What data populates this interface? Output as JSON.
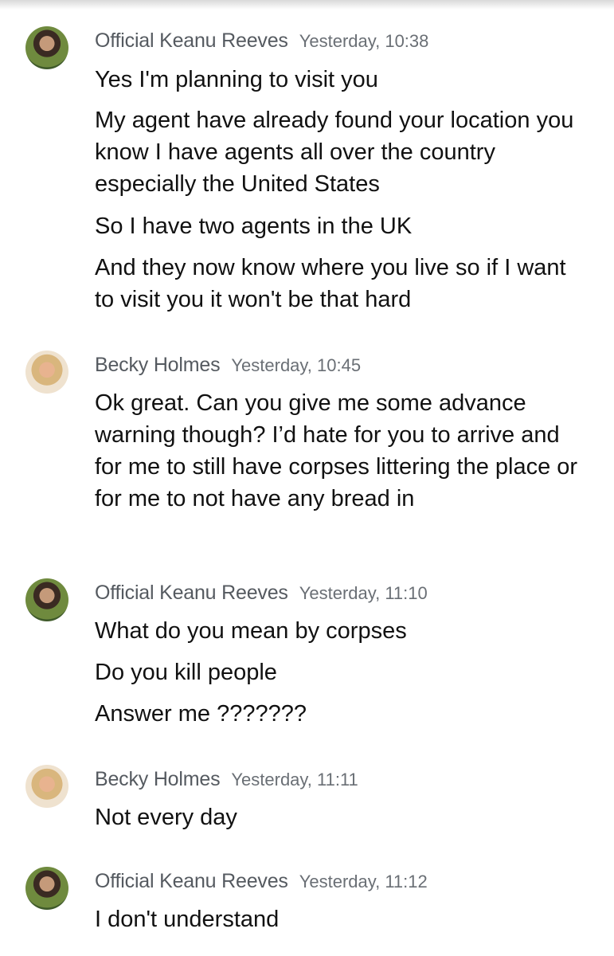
{
  "messages": [
    {
      "sender": "Official Keanu Reeves",
      "time": "Yesterday, 10:38",
      "avatar": "keanu-avatar",
      "lines": [
        "Yes I'm planning to visit you",
        "My agent have already found your location you know I have agents all over the country especially the United States",
        "So I have two agents in the UK",
        "And they now know where you live so if I want to visit you it won't be that hard"
      ]
    },
    {
      "sender": "Becky Holmes",
      "time": "Yesterday, 10:45",
      "avatar": "becky-avatar",
      "lines": [
        "Ok great. Can you give me some advance warning though? I’d hate for you to arrive and for me to still have corpses littering the place or for me to not have any bread in"
      ]
    },
    {
      "sender": "Official Keanu Reeves",
      "time": "Yesterday, 11:10",
      "avatar": "keanu-avatar",
      "lines": [
        "What do you mean by corpses",
        "Do you kill people",
        "Answer me ???????"
      ]
    },
    {
      "sender": "Becky Holmes",
      "time": "Yesterday, 11:11",
      "avatar": "becky-avatar",
      "lines": [
        "Not every day"
      ]
    },
    {
      "sender": "Official Keanu Reeves",
      "time": "Yesterday, 11:12",
      "avatar": "keanu-avatar",
      "lines": [
        "I don't understand"
      ]
    }
  ]
}
